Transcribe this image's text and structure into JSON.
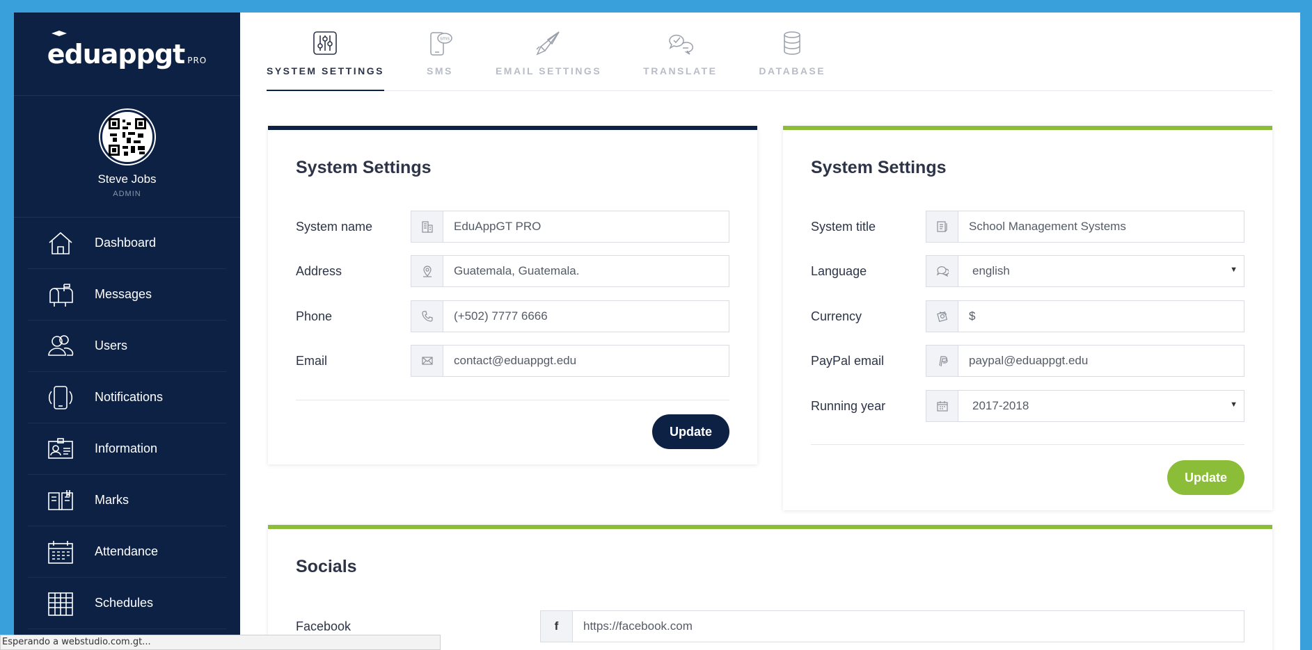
{
  "brand": {
    "name": "eduappgt",
    "suffix": "PRO"
  },
  "profile": {
    "name": "Steve Jobs",
    "role": "ADMIN"
  },
  "nav": [
    {
      "label": "Dashboard",
      "icon": "home-icon"
    },
    {
      "label": "Messages",
      "icon": "mailbox-icon"
    },
    {
      "label": "Users",
      "icon": "users-icon"
    },
    {
      "label": "Notifications",
      "icon": "phone-notification-icon"
    },
    {
      "label": "Information",
      "icon": "id-card-icon"
    },
    {
      "label": "Marks",
      "icon": "book-icon"
    },
    {
      "label": "Attendance",
      "icon": "calendar-icon"
    },
    {
      "label": "Schedules",
      "icon": "schedule-icon"
    }
  ],
  "tabs": [
    {
      "label": "SYSTEM SETTINGS",
      "icon": "sliders-icon",
      "active": true
    },
    {
      "label": "SMS",
      "icon": "sms-phone-icon",
      "active": false
    },
    {
      "label": "EMAIL SETTINGS",
      "icon": "paper-plane-icon",
      "active": false
    },
    {
      "label": "TRANSLATE",
      "icon": "chat-bubbles-icon",
      "active": false
    },
    {
      "label": "DATABASE",
      "icon": "database-icon",
      "active": false
    }
  ],
  "left_card": {
    "title": "System Settings",
    "fields": [
      {
        "label": "System name",
        "value": "EduAppGT PRO",
        "icon": "building-icon"
      },
      {
        "label": "Address",
        "value": "Guatemala, Guatemala.",
        "icon": "map-pin-icon"
      },
      {
        "label": "Phone",
        "value": "(+502) 7777 6666",
        "icon": "phone-icon"
      },
      {
        "label": "Email",
        "value": "contact@eduappgt.edu",
        "icon": "envelope-icon"
      }
    ],
    "button": "Update"
  },
  "right_card": {
    "title": "System Settings",
    "fields": [
      {
        "label": "System title",
        "value": "School Management Systems",
        "icon": "document-icon"
      },
      {
        "label": "Language",
        "value": "english",
        "icon": "language-icon",
        "select": true
      },
      {
        "label": "Currency",
        "value": "$",
        "icon": "money-icon"
      },
      {
        "label": "PayPal email",
        "value": "paypal@eduappgt.edu",
        "icon": "paypal-icon"
      },
      {
        "label": "Running year",
        "value": "2017-2018",
        "icon": "calendar-icon",
        "select": true
      }
    ],
    "button": "Update"
  },
  "socials": {
    "title": "Socials",
    "facebook_label": "Facebook",
    "facebook_value": "https://facebook.com",
    "facebook_icon_glyph": "f"
  },
  "status_bar": "Esperando a webstudio.com.gt...",
  "colors": {
    "navy": "#0c2143",
    "green": "#8bbd38",
    "background": "#3aa0dc"
  }
}
